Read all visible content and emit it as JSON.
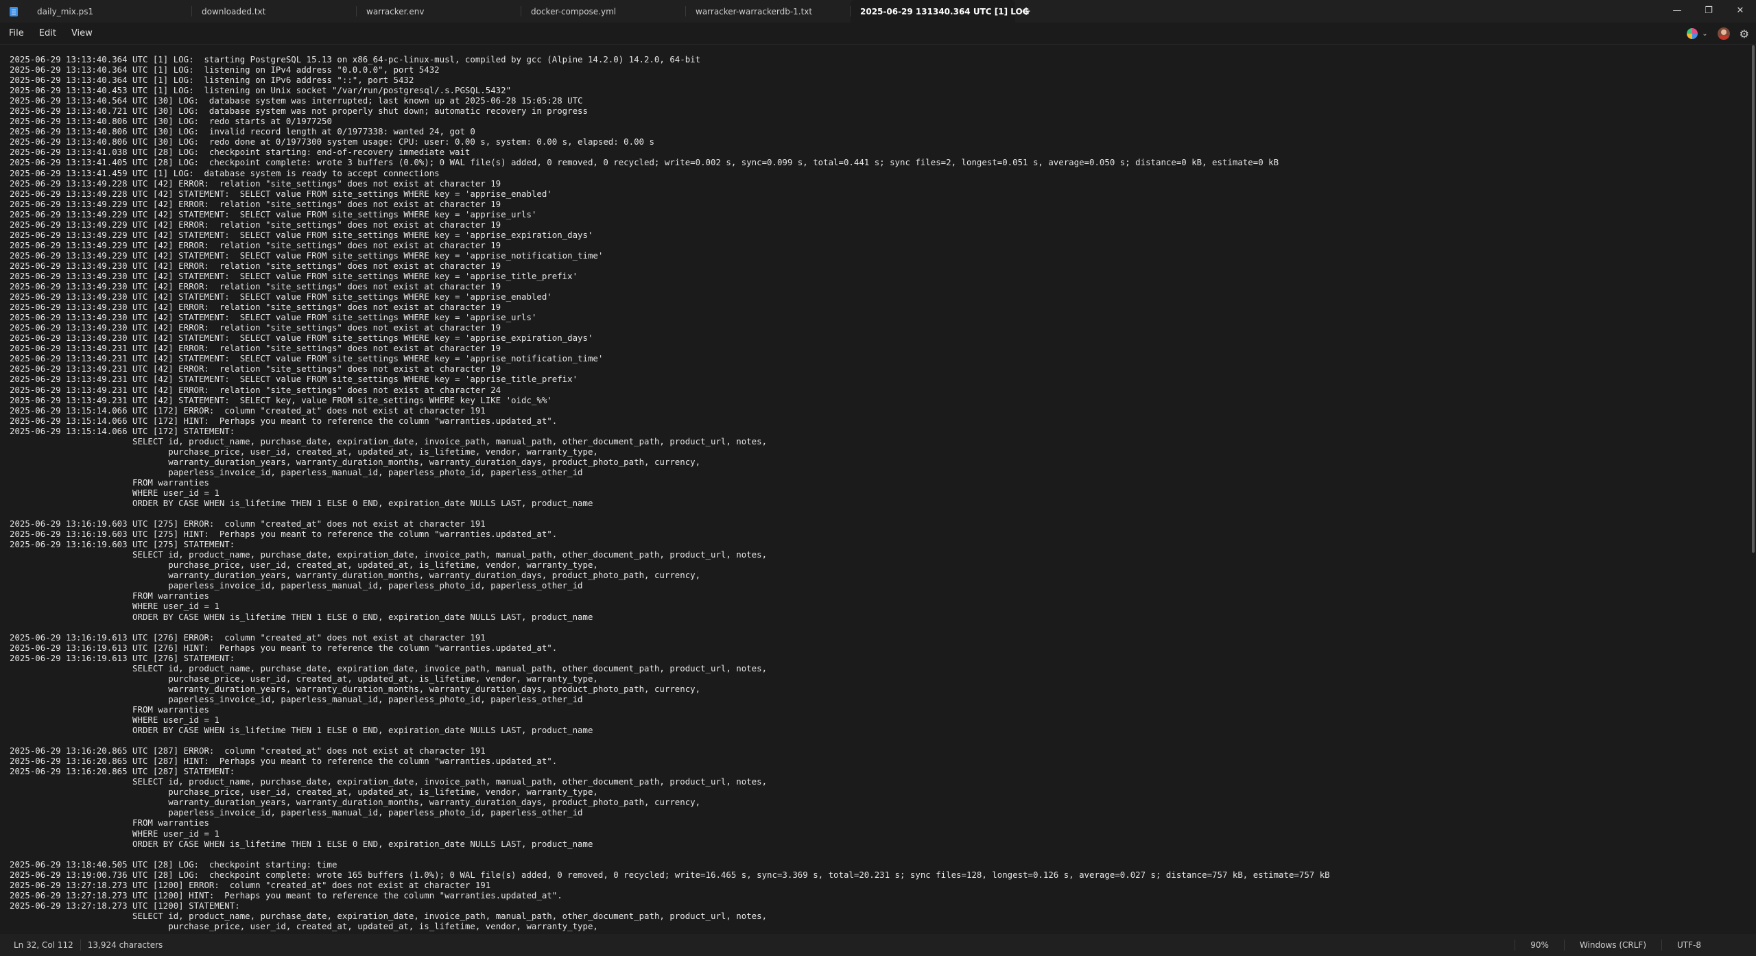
{
  "tabs": [
    {
      "label": "daily_mix.ps1",
      "active": false
    },
    {
      "label": "downloaded.txt",
      "active": false
    },
    {
      "label": "warracker.env",
      "active": false
    },
    {
      "label": "docker-compose.yml",
      "active": false
    },
    {
      "label": "warracker-warrackerdb-1.txt",
      "active": false
    },
    {
      "label": "2025-06-29 131340.364 UTC [1] LOG",
      "active": true
    }
  ],
  "new_tab_glyph": "+",
  "window_controls": {
    "minimize": "—",
    "maximize": "❐",
    "close": "✕"
  },
  "menu": {
    "file": "File",
    "edit": "Edit",
    "view": "View"
  },
  "icons": {
    "copilot": "copilot-icon",
    "avatar": "account-avatar-icon",
    "settings": "⚙",
    "chevron": "⌄"
  },
  "editor": {
    "content": "2025-06-29 13:13:40.364 UTC [1] LOG:  starting PostgreSQL 15.13 on x86_64-pc-linux-musl, compiled by gcc (Alpine 14.2.0) 14.2.0, 64-bit\n2025-06-29 13:13:40.364 UTC [1] LOG:  listening on IPv4 address \"0.0.0.0\", port 5432\n2025-06-29 13:13:40.364 UTC [1] LOG:  listening on IPv6 address \"::\", port 5432\n2025-06-29 13:13:40.453 UTC [1] LOG:  listening on Unix socket \"/var/run/postgresql/.s.PGSQL.5432\"\n2025-06-29 13:13:40.564 UTC [30] LOG:  database system was interrupted; last known up at 2025-06-28 15:05:28 UTC\n2025-06-29 13:13:40.721 UTC [30] LOG:  database system was not properly shut down; automatic recovery in progress\n2025-06-29 13:13:40.806 UTC [30] LOG:  redo starts at 0/1977250\n2025-06-29 13:13:40.806 UTC [30] LOG:  invalid record length at 0/1977338: wanted 24, got 0\n2025-06-29 13:13:40.806 UTC [30] LOG:  redo done at 0/1977300 system usage: CPU: user: 0.00 s, system: 0.00 s, elapsed: 0.00 s\n2025-06-29 13:13:41.038 UTC [28] LOG:  checkpoint starting: end-of-recovery immediate wait\n2025-06-29 13:13:41.405 UTC [28] LOG:  checkpoint complete: wrote 3 buffers (0.0%); 0 WAL file(s) added, 0 removed, 0 recycled; write=0.002 s, sync=0.099 s, total=0.441 s; sync files=2, longest=0.051 s, average=0.050 s; distance=0 kB, estimate=0 kB\n2025-06-29 13:13:41.459 UTC [1] LOG:  database system is ready to accept connections\n2025-06-29 13:13:49.228 UTC [42] ERROR:  relation \"site_settings\" does not exist at character 19\n2025-06-29 13:13:49.228 UTC [42] STATEMENT:  SELECT value FROM site_settings WHERE key = 'apprise_enabled'\n2025-06-29 13:13:49.229 UTC [42] ERROR:  relation \"site_settings\" does not exist at character 19\n2025-06-29 13:13:49.229 UTC [42] STATEMENT:  SELECT value FROM site_settings WHERE key = 'apprise_urls'\n2025-06-29 13:13:49.229 UTC [42] ERROR:  relation \"site_settings\" does not exist at character 19\n2025-06-29 13:13:49.229 UTC [42] STATEMENT:  SELECT value FROM site_settings WHERE key = 'apprise_expiration_days'\n2025-06-29 13:13:49.229 UTC [42] ERROR:  relation \"site_settings\" does not exist at character 19\n2025-06-29 13:13:49.229 UTC [42] STATEMENT:  SELECT value FROM site_settings WHERE key = 'apprise_notification_time'\n2025-06-29 13:13:49.230 UTC [42] ERROR:  relation \"site_settings\" does not exist at character 19\n2025-06-29 13:13:49.230 UTC [42] STATEMENT:  SELECT value FROM site_settings WHERE key = 'apprise_title_prefix'\n2025-06-29 13:13:49.230 UTC [42] ERROR:  relation \"site_settings\" does not exist at character 19\n2025-06-29 13:13:49.230 UTC [42] STATEMENT:  SELECT value FROM site_settings WHERE key = 'apprise_enabled'\n2025-06-29 13:13:49.230 UTC [42] ERROR:  relation \"site_settings\" does not exist at character 19\n2025-06-29 13:13:49.230 UTC [42] STATEMENT:  SELECT value FROM site_settings WHERE key = 'apprise_urls'\n2025-06-29 13:13:49.230 UTC [42] ERROR:  relation \"site_settings\" does not exist at character 19\n2025-06-29 13:13:49.230 UTC [42] STATEMENT:  SELECT value FROM site_settings WHERE key = 'apprise_expiration_days'\n2025-06-29 13:13:49.231 UTC [42] ERROR:  relation \"site_settings\" does not exist at character 19\n2025-06-29 13:13:49.231 UTC [42] STATEMENT:  SELECT value FROM site_settings WHERE key = 'apprise_notification_time'\n2025-06-29 13:13:49.231 UTC [42] ERROR:  relation \"site_settings\" does not exist at character 19\n2025-06-29 13:13:49.231 UTC [42] STATEMENT:  SELECT value FROM site_settings WHERE key = 'apprise_title_prefix'\n2025-06-29 13:13:49.231 UTC [42] ERROR:  relation \"site_settings\" does not exist at character 24\n2025-06-29 13:13:49.231 UTC [42] STATEMENT:  SELECT key, value FROM site_settings WHERE key LIKE 'oidc_%%'\n2025-06-29 13:15:14.066 UTC [172] ERROR:  column \"created_at\" does not exist at character 191\n2025-06-29 13:15:14.066 UTC [172] HINT:  Perhaps you meant to reference the column \"warranties.updated_at\".\n2025-06-29 13:15:14.066 UTC [172] STATEMENT:  \n\t                SELECT id, product_name, purchase_date, expiration_date, invoice_path, manual_path, other_document_path, product_url, notes,\n\t                       purchase_price, user_id, created_at, updated_at, is_lifetime, vendor, warranty_type,\n\t                       warranty_duration_years, warranty_duration_months, warranty_duration_days, product_photo_path, currency,\n\t                       paperless_invoice_id, paperless_manual_id, paperless_photo_id, paperless_other_id\n\t                FROM warranties\n\t                WHERE user_id = 1\n\t                ORDER BY CASE WHEN is_lifetime THEN 1 ELSE 0 END, expiration_date NULLS LAST, product_name\n\t            \n2025-06-29 13:16:19.603 UTC [275] ERROR:  column \"created_at\" does not exist at character 191\n2025-06-29 13:16:19.603 UTC [275] HINT:  Perhaps you meant to reference the column \"warranties.updated_at\".\n2025-06-29 13:16:19.603 UTC [275] STATEMENT:  \n\t                SELECT id, product_name, purchase_date, expiration_date, invoice_path, manual_path, other_document_path, product_url, notes,\n\t                       purchase_price, user_id, created_at, updated_at, is_lifetime, vendor, warranty_type,\n\t                       warranty_duration_years, warranty_duration_months, warranty_duration_days, product_photo_path, currency,\n\t                       paperless_invoice_id, paperless_manual_id, paperless_photo_id, paperless_other_id\n\t                FROM warranties\n\t                WHERE user_id = 1\n\t                ORDER BY CASE WHEN is_lifetime THEN 1 ELSE 0 END, expiration_date NULLS LAST, product_name\n\t            \n2025-06-29 13:16:19.613 UTC [276] ERROR:  column \"created_at\" does not exist at character 191\n2025-06-29 13:16:19.613 UTC [276] HINT:  Perhaps you meant to reference the column \"warranties.updated_at\".\n2025-06-29 13:16:19.613 UTC [276] STATEMENT:  \n\t                SELECT id, product_name, purchase_date, expiration_date, invoice_path, manual_path, other_document_path, product_url, notes,\n\t                       purchase_price, user_id, created_at, updated_at, is_lifetime, vendor, warranty_type,\n\t                       warranty_duration_years, warranty_duration_months, warranty_duration_days, product_photo_path, currency,\n\t                       paperless_invoice_id, paperless_manual_id, paperless_photo_id, paperless_other_id\n\t                FROM warranties\n\t                WHERE user_id = 1\n\t                ORDER BY CASE WHEN is_lifetime THEN 1 ELSE 0 END, expiration_date NULLS LAST, product_name\n\t            \n2025-06-29 13:16:20.865 UTC [287] ERROR:  column \"created_at\" does not exist at character 191\n2025-06-29 13:16:20.865 UTC [287] HINT:  Perhaps you meant to reference the column \"warranties.updated_at\".\n2025-06-29 13:16:20.865 UTC [287] STATEMENT:  \n\t                SELECT id, product_name, purchase_date, expiration_date, invoice_path, manual_path, other_document_path, product_url, notes,\n\t                       purchase_price, user_id, created_at, updated_at, is_lifetime, vendor, warranty_type,\n\t                       warranty_duration_years, warranty_duration_months, warranty_duration_days, product_photo_path, currency,\n\t                       paperless_invoice_id, paperless_manual_id, paperless_photo_id, paperless_other_id\n\t                FROM warranties\n\t                WHERE user_id = 1\n\t                ORDER BY CASE WHEN is_lifetime THEN 1 ELSE 0 END, expiration_date NULLS LAST, product_name\n\t            \n2025-06-29 13:18:40.505 UTC [28] LOG:  checkpoint starting: time\n2025-06-29 13:19:00.736 UTC [28] LOG:  checkpoint complete: wrote 165 buffers (1.0%); 0 WAL file(s) added, 0 removed, 0 recycled; write=16.465 s, sync=3.369 s, total=20.231 s; sync files=128, longest=0.126 s, average=0.027 s; distance=757 kB, estimate=757 kB\n2025-06-29 13:27:18.273 UTC [1200] ERROR:  column \"created_at\" does not exist at character 191\n2025-06-29 13:27:18.273 UTC [1200] HINT:  Perhaps you meant to reference the column \"warranties.updated_at\".\n2025-06-29 13:27:18.273 UTC [1200] STATEMENT:  \n\t                SELECT id, product_name, purchase_date, expiration_date, invoice_path, manual_path, other_document_path, product_url, notes,\n\t                       purchase_price, user_id, created_at, updated_at, is_lifetime, vendor, warranty_type,"
  },
  "status": {
    "position": "Ln 32, Col 112",
    "characters": "13,924 characters",
    "zoom": "90%",
    "line_ending": "Windows (CRLF)",
    "encoding": "UTF-8"
  }
}
